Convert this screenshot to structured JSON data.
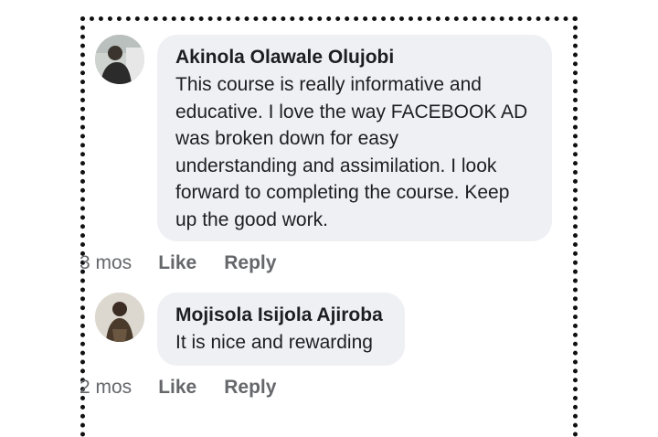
{
  "comments": [
    {
      "author": "Akinola Olawale Olujobi",
      "text": "This course is really informative and\neducative. I love the way FACEBOOK AD\nwas broken down for easy\nunderstanding and assimilation. I look\nforward to completing the course. Keep\nup the good work.",
      "time": "3 mos",
      "like_label": "Like",
      "reply_label": "Reply"
    },
    {
      "author": "Mojisola Isijola Ajiroba",
      "text": "It is nice and rewarding",
      "time": "2 mos",
      "like_label": "Like",
      "reply_label": "Reply"
    }
  ],
  "colors": {
    "bubble": "#eff0f3",
    "author_text": "#1c1e21",
    "meta_text": "#65676b",
    "frame_border": "#111111"
  }
}
